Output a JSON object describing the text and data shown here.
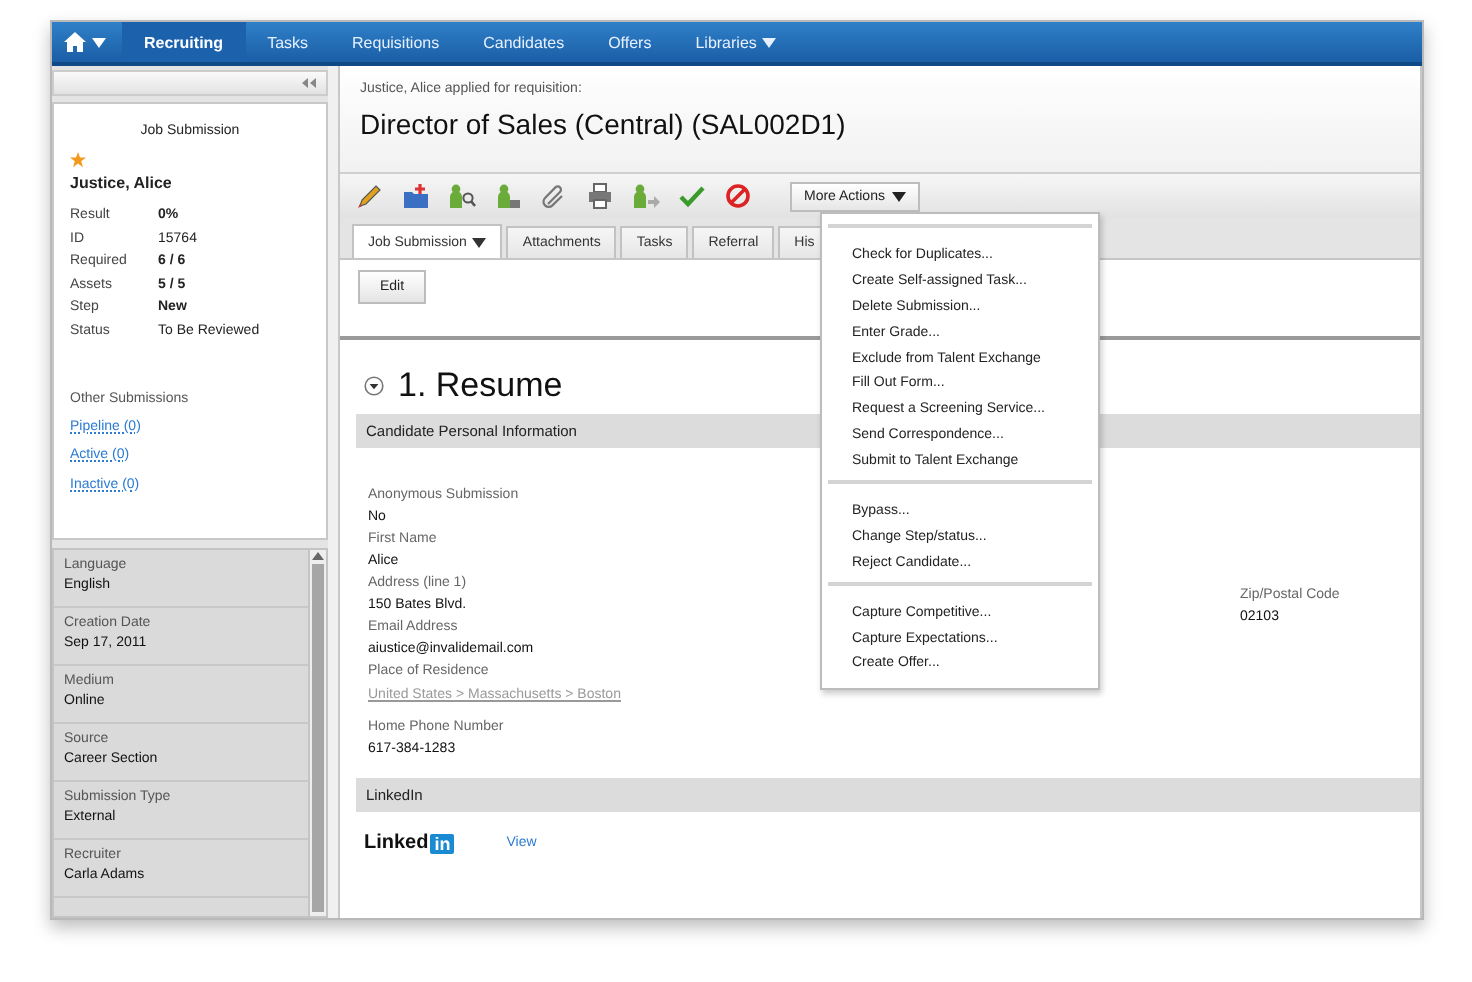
{
  "nav": {
    "items": [
      {
        "label": "Recruiting",
        "selected": true,
        "has_menu": false
      },
      {
        "label": "Tasks",
        "selected": false,
        "has_menu": false
      },
      {
        "label": "Requisitions",
        "selected": false,
        "has_menu": false
      },
      {
        "label": "Candidates",
        "selected": false,
        "has_menu": false
      },
      {
        "label": "Offers",
        "selected": false,
        "has_menu": false
      },
      {
        "label": "Libraries",
        "selected": false,
        "has_menu": true
      }
    ]
  },
  "card": {
    "title": "Job Submission",
    "starred": true,
    "name": "Justice, Alice",
    "details": [
      {
        "label": "Result",
        "value": "0%",
        "kind": "bold"
      },
      {
        "label": "ID",
        "value": "15764",
        "kind": "plain"
      },
      {
        "label": "Required",
        "value": "6 / 6",
        "kind": "bold"
      },
      {
        "label": "Assets",
        "value": "5 / 5",
        "kind": "bold"
      },
      {
        "label": "Step",
        "value": "New",
        "kind": "bold"
      },
      {
        "label": "Status",
        "value": "To Be Reviewed",
        "kind": "plain"
      }
    ],
    "other_title": "Other Submissions",
    "links": [
      "Pipeline (0)",
      "Active (0)",
      "Inactive (0)"
    ]
  },
  "properties": [
    {
      "label": "Language",
      "value": "English"
    },
    {
      "label": "Creation Date",
      "value": "Sep 17, 2011"
    },
    {
      "label": "Medium",
      "value": "Online"
    },
    {
      "label": "Source",
      "value": "Career Section"
    },
    {
      "label": "Submission Type",
      "value": "External"
    },
    {
      "label": "Recruiter",
      "value": "Carla Adams"
    }
  ],
  "main": {
    "subtitle": "Justice, Alice applied for requisition:",
    "title": "Director of Sales (Central) (SAL002D1)",
    "more_actions": "More Actions",
    "tabs": [
      {
        "label": "Job Submission",
        "selected": true,
        "has_menu": true
      },
      {
        "label": "Attachments",
        "selected": false,
        "has_menu": false
      },
      {
        "label": "Tasks",
        "selected": false,
        "has_menu": false
      },
      {
        "label": "Referral",
        "selected": false,
        "has_menu": false
      },
      {
        "label": "His",
        "selected": false,
        "has_menu": false
      }
    ],
    "edit": "Edit",
    "section_heading": "1. Resume",
    "expanded": true,
    "section_title": "Candidate Personal Information",
    "fields": [
      {
        "label": "Anonymous Submission",
        "value": "No",
        "kind": "text"
      },
      {
        "label": "First Name",
        "value": "Alice",
        "kind": "text"
      },
      {
        "label": "Address (line 1)",
        "value": "150 Bates Blvd.",
        "kind": "text"
      },
      {
        "label": "Email Address",
        "value": "aiustice@invalidemail.com",
        "kind": "text"
      },
      {
        "label": "Place of Residence",
        "value": "United States > Massachusetts > Boston",
        "kind": "link"
      },
      {
        "label": "Home Phone Number",
        "value": "617-384-1283",
        "kind": "text"
      }
    ],
    "side_field": {
      "label": "Zip/Postal Code",
      "value": "02103"
    },
    "linkedin": {
      "title": "LinkedIn",
      "logo_text": "Linked",
      "logo_badge": "in",
      "link": "View"
    }
  },
  "menu": {
    "groups": [
      [
        "Check for Duplicates...",
        "Create Self-assigned Task...",
        "Delete Submission...",
        "Enter Grade...",
        "Exclude from Talent Exchange",
        "Fill Out Form...",
        "Request a Screening Service...",
        "Send Correspondence...",
        "Submit to Talent Exchange"
      ],
      [
        "Bypass...",
        "Change Step/status...",
        "Reject Candidate..."
      ],
      [
        "Capture Competitive...",
        "Capture Expectations...",
        "Create Offer..."
      ]
    ]
  }
}
